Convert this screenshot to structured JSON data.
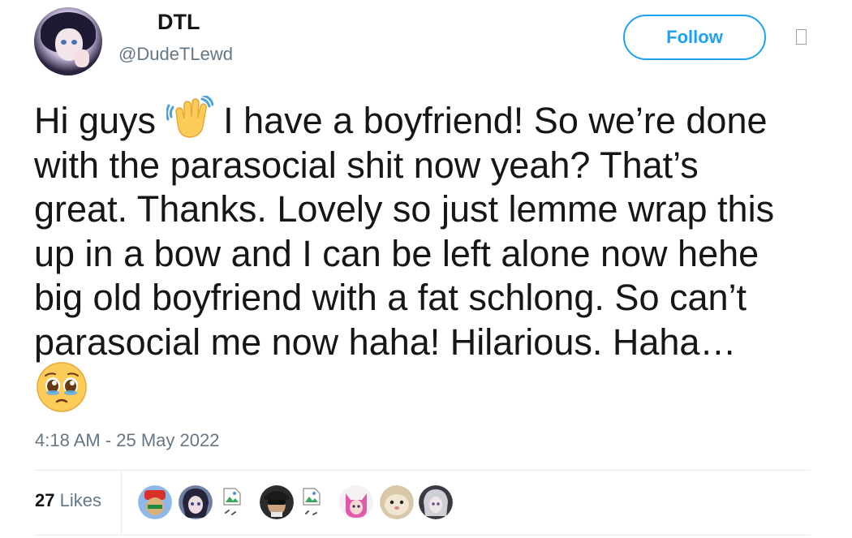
{
  "author": {
    "display_name": "DTL",
    "handle": "@DudeTLewd"
  },
  "follow_button": {
    "label": "Follow"
  },
  "tweet": {
    "line1_before_emoji": "Hi guys ",
    "line1_after_emoji": " I have a boyfriend! So we’re done",
    "lines": [
      "with the parasocial shit now yeah? That’s",
      "great. Thanks. Lovely so just lemme wrap this",
      "up in a bow and I can be left alone now hehe",
      "big old boyfriend with a fat schlong. So can’t",
      "parasocial me now haha! Hilarious. Haha…"
    ],
    "emojis": [
      "waving-hand-emoji",
      "pleading-face-emoji"
    ],
    "timestamp": "4:18 AM - 25 May 2022"
  },
  "stats": {
    "likes_count": "27",
    "likes_label": "Likes"
  },
  "likers": [
    "avatar-red-hat",
    "avatar-anime-dark",
    "avatar-broken-image",
    "avatar-sunglasses",
    "avatar-broken-image",
    "avatar-pink-cat",
    "avatar-cat-face",
    "avatar-anime-grey"
  ],
  "colors": {
    "accent": "#1da1f2",
    "text": "#14171a",
    "secondary_text": "#657786",
    "divider": "#e6ecf0"
  }
}
